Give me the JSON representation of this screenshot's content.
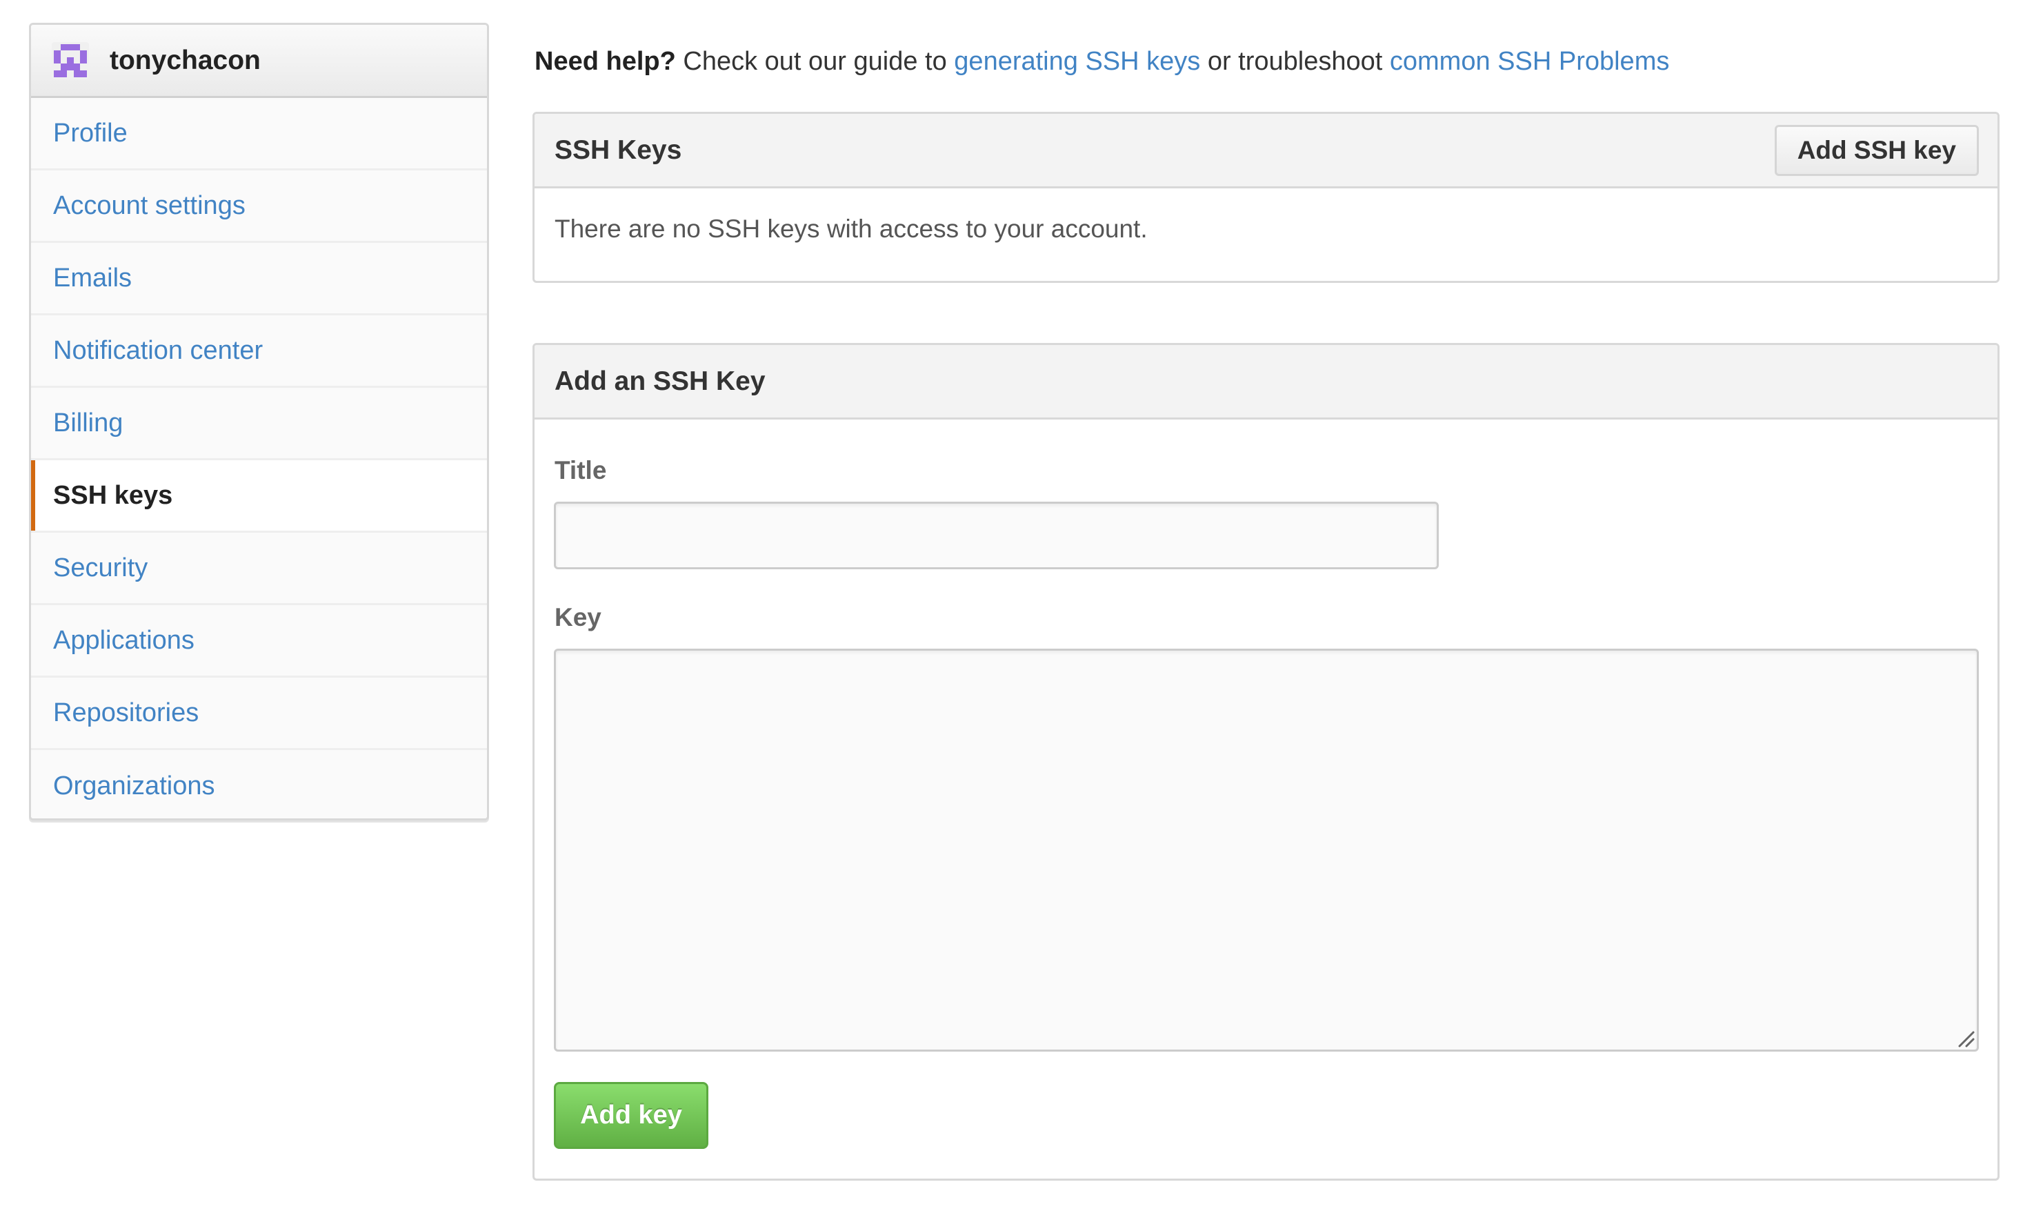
{
  "user": {
    "username": "tonychacon",
    "avatar": {
      "icon": "identicon",
      "color": "#9a6ee0",
      "grid": [
        [
          0,
          1,
          1,
          1,
          0
        ],
        [
          1,
          0,
          0,
          0,
          1
        ],
        [
          1,
          0,
          1,
          0,
          1
        ],
        [
          0,
          1,
          1,
          1,
          0
        ],
        [
          1,
          1,
          0,
          1,
          1
        ]
      ]
    }
  },
  "sidebar": {
    "items": [
      {
        "label": "Profile",
        "selected": false
      },
      {
        "label": "Account settings",
        "selected": false
      },
      {
        "label": "Emails",
        "selected": false
      },
      {
        "label": "Notification center",
        "selected": false
      },
      {
        "label": "Billing",
        "selected": false
      },
      {
        "label": "SSH keys",
        "selected": true
      },
      {
        "label": "Security",
        "selected": false
      },
      {
        "label": "Applications",
        "selected": false
      },
      {
        "label": "Repositories",
        "selected": false
      },
      {
        "label": "Organizations",
        "selected": false
      }
    ],
    "accent_color": "#d26911"
  },
  "help": {
    "prefix_bold": "Need help?",
    "text1": " Check out our guide to ",
    "link1": "generating SSH keys",
    "text2": " or troubleshoot ",
    "link2": "common SSH Problems"
  },
  "ssh_keys_panel": {
    "title": "SSH Keys",
    "add_button": "Add SSH key",
    "empty_message": "There are no SSH keys with access to your account."
  },
  "add_key_panel": {
    "title": "Add an SSH Key",
    "title_label": "Title",
    "title_value": "",
    "key_label": "Key",
    "key_value": "",
    "submit_button": "Add key"
  },
  "colors": {
    "link": "#4183c4",
    "primary_button_top": "#8add6d",
    "primary_button_bottom": "#60b044"
  }
}
